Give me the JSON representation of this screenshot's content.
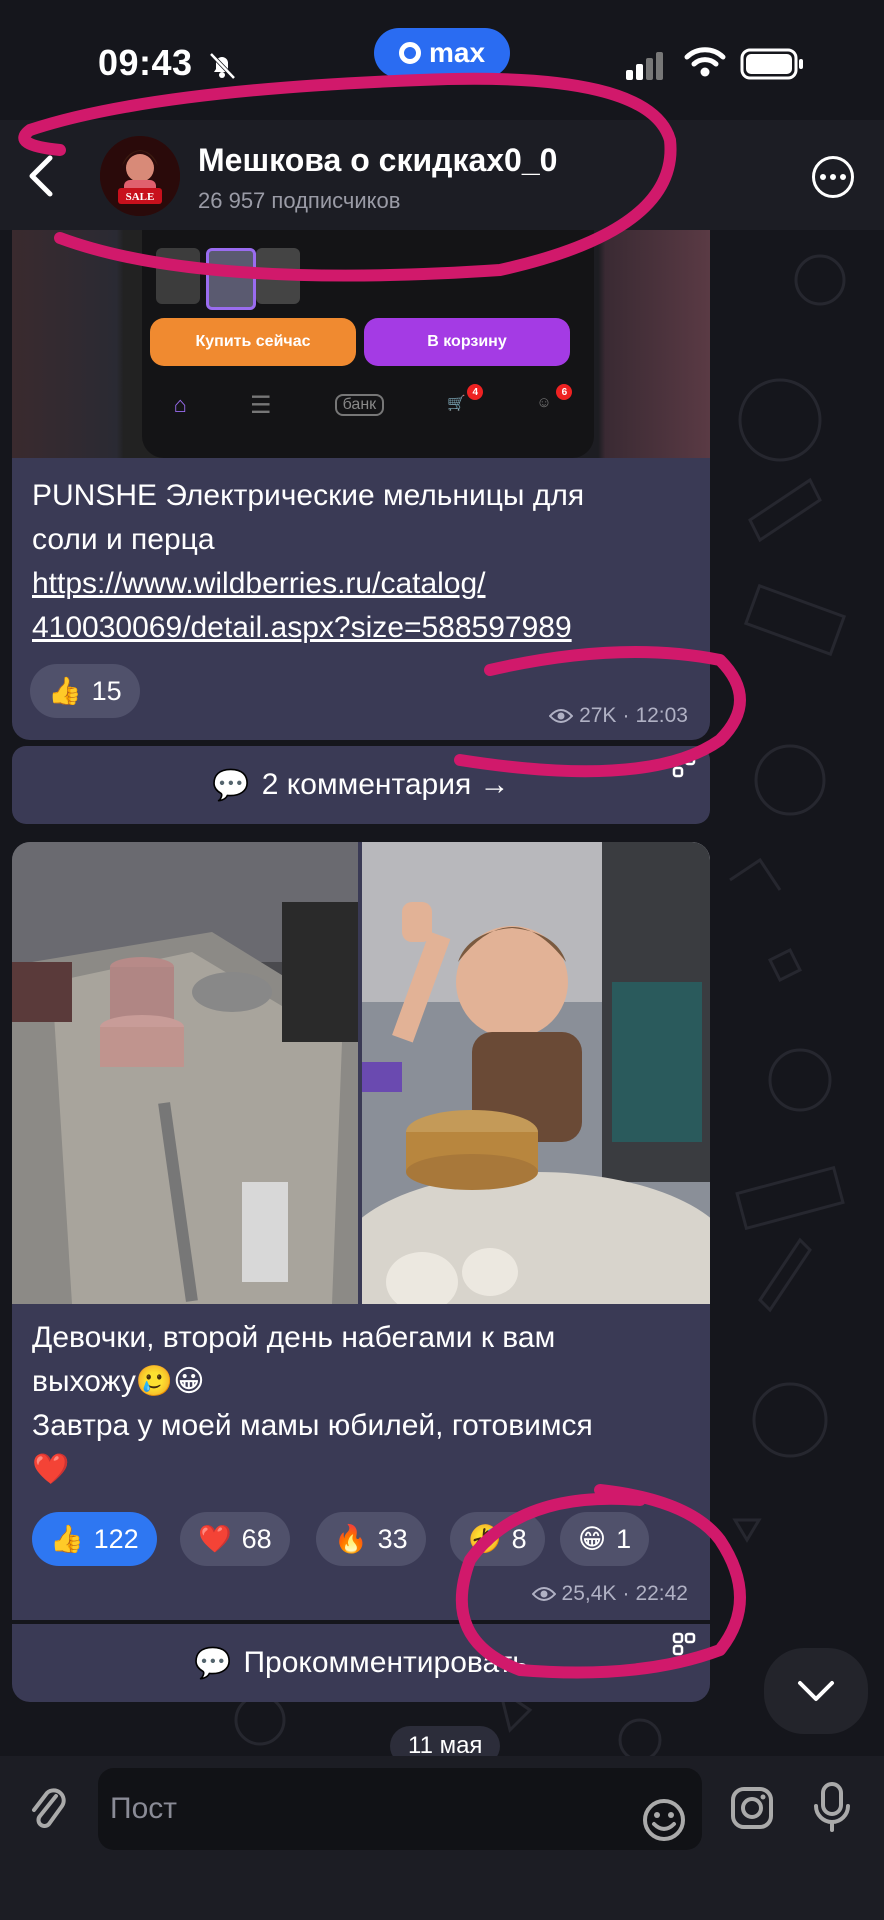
{
  "status_bar": {
    "time": "09:43",
    "pill_label": "max",
    "icons": [
      "bell-slash-icon",
      "signal-icon",
      "wifi-icon",
      "battery-icon"
    ]
  },
  "header": {
    "channel_name": "Мешкова о скидках0_0",
    "subscribers": "26 957 подписчиков",
    "avatar_text": "SALE",
    "icons": [
      "back-chevron-icon",
      "more-icon"
    ]
  },
  "post1": {
    "screenshot": {
      "buy_now": "Купить сейчас",
      "to_cart": "В корзину",
      "nav_bank": "банк",
      "cart_badge": "4",
      "profile_badge": "6"
    },
    "text_line1": "PUNSHE Электрические мельницы для",
    "text_line2": "соли и перца",
    "link_line1": "https://www.wildberries.ru/catalog/",
    "link_line2": "410030069/detail.aspx?size=588597989",
    "reaction_emoji": "👍",
    "reaction_count": "15",
    "views": "27K",
    "time": "12:03",
    "comments": "2 комментария →"
  },
  "post2": {
    "line1": "Девочки, второй день набегами к вам",
    "line2": "выхожу🥲😀",
    "line3": "Завтра у моей мамы юбилей, готовимся",
    "line4": "❤️",
    "reactions": [
      {
        "emoji": "👍",
        "count": "122",
        "selected": true
      },
      {
        "emoji": "❤️",
        "count": "68",
        "selected": false
      },
      {
        "emoji": "🔥",
        "count": "33",
        "selected": false
      },
      {
        "emoji": "🤣",
        "count": "8",
        "selected": false
      },
      {
        "emoji": "😁",
        "count": "1",
        "selected": false
      }
    ],
    "views": "25,4K",
    "time": "22:42",
    "comment_cta": "Прокомментировать"
  },
  "date_divider": "11 мая",
  "composer": {
    "placeholder": "Пост",
    "icons": [
      "paperclip-icon",
      "emoji-icon",
      "instagram-icon",
      "microphone-icon"
    ]
  },
  "colors": {
    "bubble": "#3a3a55",
    "accent": "#2e77f2",
    "annotation": "#d1196b"
  }
}
